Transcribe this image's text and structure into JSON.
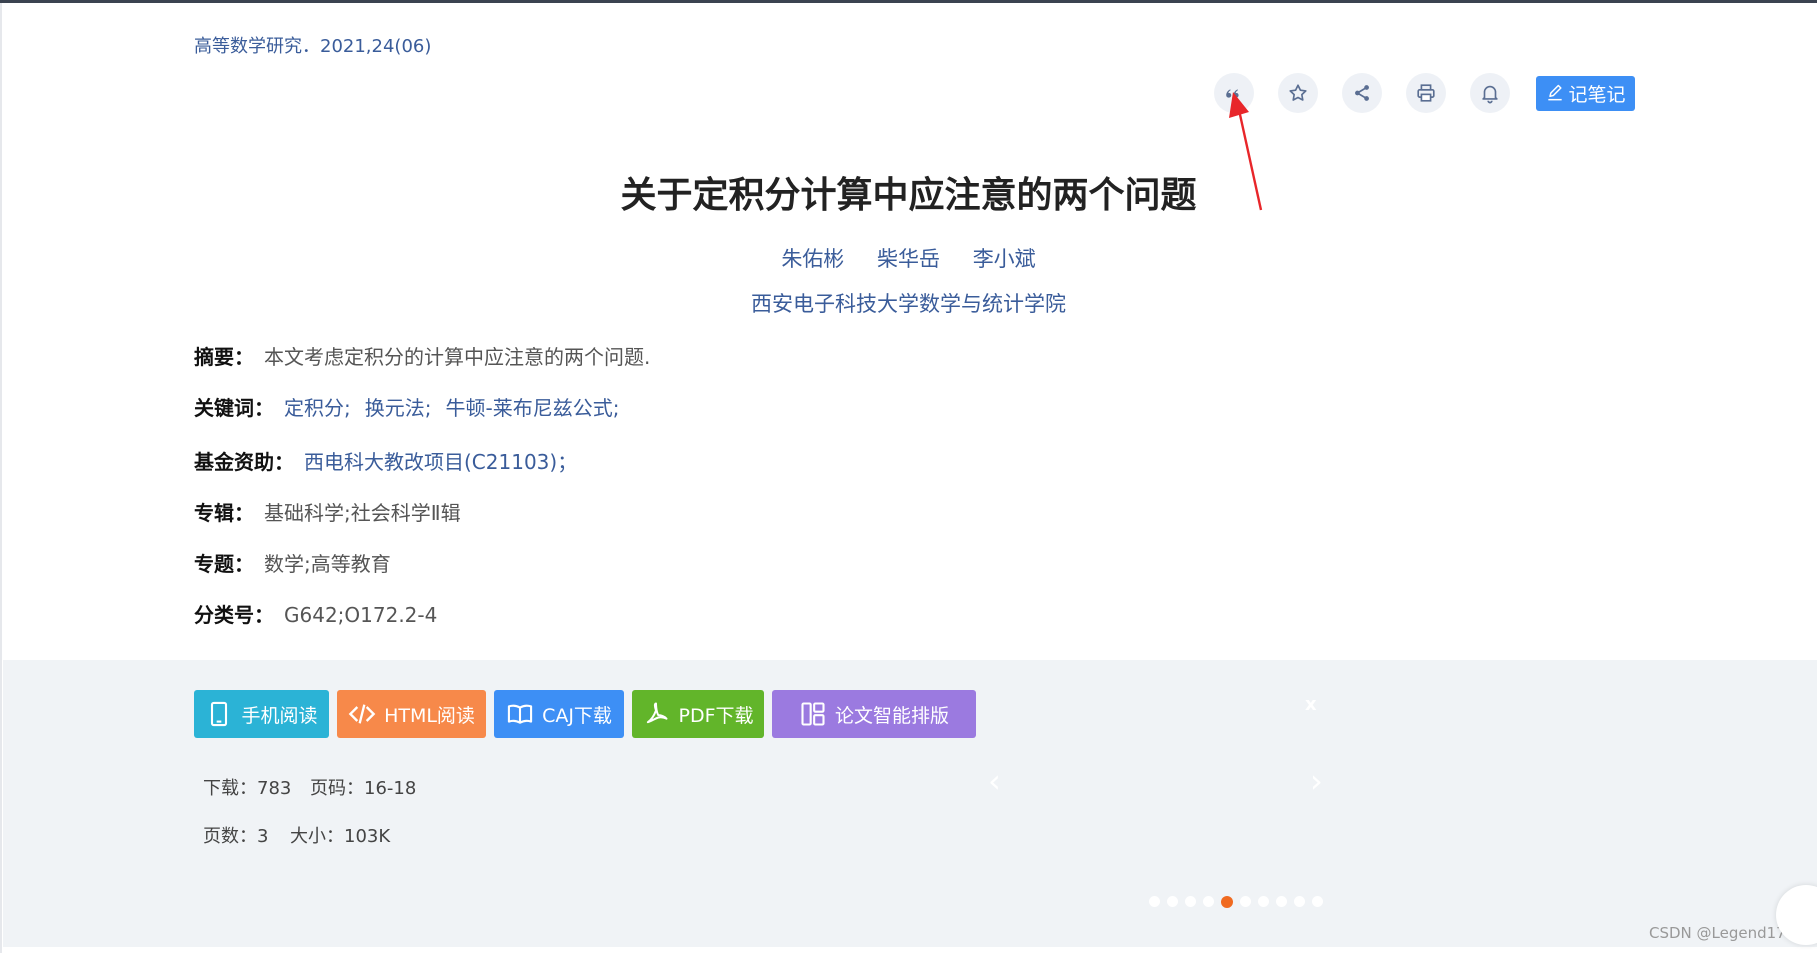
{
  "journal": "高等数学研究．2021,24(06)",
  "toolbar": {
    "icons": [
      "quote-icon",
      "star-icon",
      "share-icon",
      "print-icon",
      "bell-icon"
    ],
    "note_label": "记笔记"
  },
  "title": "关于定积分计算中应注意的两个问题",
  "authors": [
    "朱佑彬",
    "柴华岳",
    "李小斌"
  ],
  "affiliation": "西安电子科技大学数学与统计学院",
  "meta": {
    "abstract_label": "摘要：",
    "abstract": "本文考虑定积分的计算中应注意的两个问题.",
    "keywords_label": "关键词：",
    "keywords": [
      "定积分;",
      "换元法;",
      "牛顿-莱布尼兹公式;"
    ],
    "fund_label": "基金资助：",
    "fund": "西电科大教改项目(C21103)；",
    "series_label": "专辑：",
    "series": "基础科学;社会科学Ⅱ辑",
    "subject_label": "专题：",
    "subject": "数学;高等教育",
    "class_label": "分类号：",
    "class": "G642;O172.2-4"
  },
  "actions": {
    "mobile": "手机阅读",
    "html": "HTML阅读",
    "caj": "CAJ下载",
    "pdf": "PDF下载",
    "layout": "论文智能排版"
  },
  "colors": {
    "mobile": "#2bb3d6",
    "html": "#f7894a",
    "caj": "#3d8ff5",
    "pdf": "#62b52a",
    "layout": "#9b7ae0",
    "accent_dot": "#f06a20",
    "link": "#3a5c9a"
  },
  "stats": {
    "downloads_label": "下载：",
    "downloads": "783",
    "pages_label": "页码：",
    "pages": "16-18",
    "page_count_label": "页数：",
    "page_count": "3",
    "size_label": "大小：",
    "size": "103K"
  },
  "carousel": {
    "close": "x",
    "prev": "‹",
    "next": "›",
    "dot_count": 10,
    "active_dot": 5
  },
  "watermark": "CSDN @Legend1729"
}
